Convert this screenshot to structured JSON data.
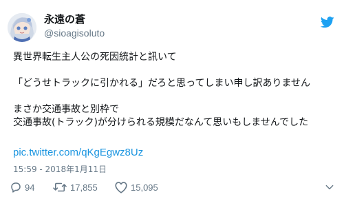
{
  "author": {
    "display_name": "永遠の蒼",
    "handle": "@sioagisoluto"
  },
  "tweet": {
    "lines": [
      "異世界転生主人公の死因統計と訊いて",
      "",
      "「どうせトラックに引かれる」だろと思ってしまい申し訳ありません",
      "",
      "まさか交通事故と別枠で",
      "交通事故(トラック)が分けられる規模だなんて思いもしませんでした"
    ],
    "link": "pic.twitter.com/qKgEgwz8Uz",
    "timestamp": "15:59 - 2018年1月11日"
  },
  "actions": {
    "reply_count": "94",
    "retweet_count": "17,855",
    "like_count": "15,095"
  },
  "icons": {
    "brand": "twitter-bird-icon",
    "reply": "reply-icon",
    "retweet": "retweet-icon",
    "like": "heart-icon",
    "more": "more-icon"
  },
  "colors": {
    "brand": "#1da1f2",
    "link": "#1b95e0",
    "muted": "#657786",
    "text": "#14171a"
  }
}
